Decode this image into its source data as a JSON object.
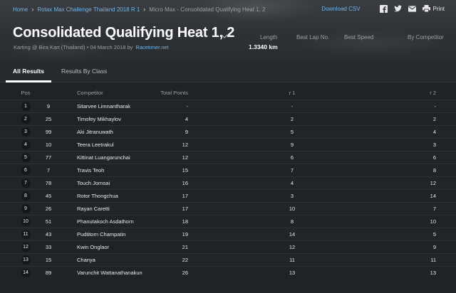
{
  "breadcrumb": [
    {
      "label": "Home"
    },
    {
      "label": "Rotax Max Challenge Thailand 2018 R 1"
    },
    {
      "label": "Micro Max - Consolidated Qualifying Heat 1, 2"
    }
  ],
  "actions": {
    "download_csv": "Download CSV",
    "print": "Print"
  },
  "title": "Consolidated Qualifying Heat 1, 2",
  "subtitle": {
    "text": "Karting @ Bira Kart (Thailand) • 04 March 2018 by",
    "link": "Racetimer.net"
  },
  "stats": {
    "length_label": "Length",
    "length_value": "1.3340 km",
    "best_lap_label": "Best Lap No.",
    "best_speed_label": "Best Speed",
    "by_competitor_label": "By Competitor"
  },
  "tabs": [
    {
      "label": "All Results"
    },
    {
      "label": "Results By Class"
    }
  ],
  "table": {
    "headers": {
      "pos": "Pos",
      "competitor": "Competitor",
      "total_points": "Total Points",
      "r1": "r 1",
      "r2": "r 2"
    },
    "rows": [
      {
        "pos": "1",
        "num": "9",
        "name": "Sitarvee Limnantharak",
        "pts": "-",
        "r1": "-",
        "r2": "-"
      },
      {
        "pos": "2",
        "num": "25",
        "name": "Timofey Mikhaylov",
        "pts": "4",
        "r1": "2",
        "r2": "2"
      },
      {
        "pos": "3",
        "num": "99",
        "name": "Aki Jitranuwath",
        "pts": "9",
        "r1": "5",
        "r2": "4"
      },
      {
        "pos": "4",
        "num": "10",
        "name": "Teera Leetrakul",
        "pts": "12",
        "r1": "9",
        "r2": "3"
      },
      {
        "pos": "5",
        "num": "77",
        "name": "Kittinat Luangarunchai",
        "pts": "12",
        "r1": "6",
        "r2": "6"
      },
      {
        "pos": "6",
        "num": "7",
        "name": "Travis Teoh",
        "pts": "15",
        "r1": "7",
        "r2": "8"
      },
      {
        "pos": "7",
        "num": "78",
        "name": "Touch Jornsai",
        "pts": "16",
        "r1": "4",
        "r2": "12"
      },
      {
        "pos": "8",
        "num": "45",
        "name": "Rotor Thongchua",
        "pts": "17",
        "r1": "3",
        "r2": "14"
      },
      {
        "pos": "9",
        "num": "26",
        "name": "Rayan Caretti",
        "pts": "17",
        "r1": "10",
        "r2": "7"
      },
      {
        "pos": "10",
        "num": "51",
        "name": "Phanutakoch Asdathorn",
        "pts": "18",
        "r1": "8",
        "r2": "10"
      },
      {
        "pos": "11",
        "num": "43",
        "name": "Pudtitorn Champatin",
        "pts": "19",
        "r1": "14",
        "r2": "5"
      },
      {
        "pos": "12",
        "num": "33",
        "name": "Kwin Onglaor",
        "pts": "21",
        "r1": "12",
        "r2": "9"
      },
      {
        "pos": "13",
        "num": "15",
        "name": "Chanya",
        "pts": "22",
        "r1": "11",
        "r2": "11"
      },
      {
        "pos": "14",
        "num": "89",
        "name": "Varunchit Wattanathanakun",
        "pts": "26",
        "r1": "13",
        "r2": "13"
      }
    ]
  },
  "colors": {
    "link": "#6fb6e8",
    "background": "#1f2226",
    "text": "#e8e8e8"
  }
}
